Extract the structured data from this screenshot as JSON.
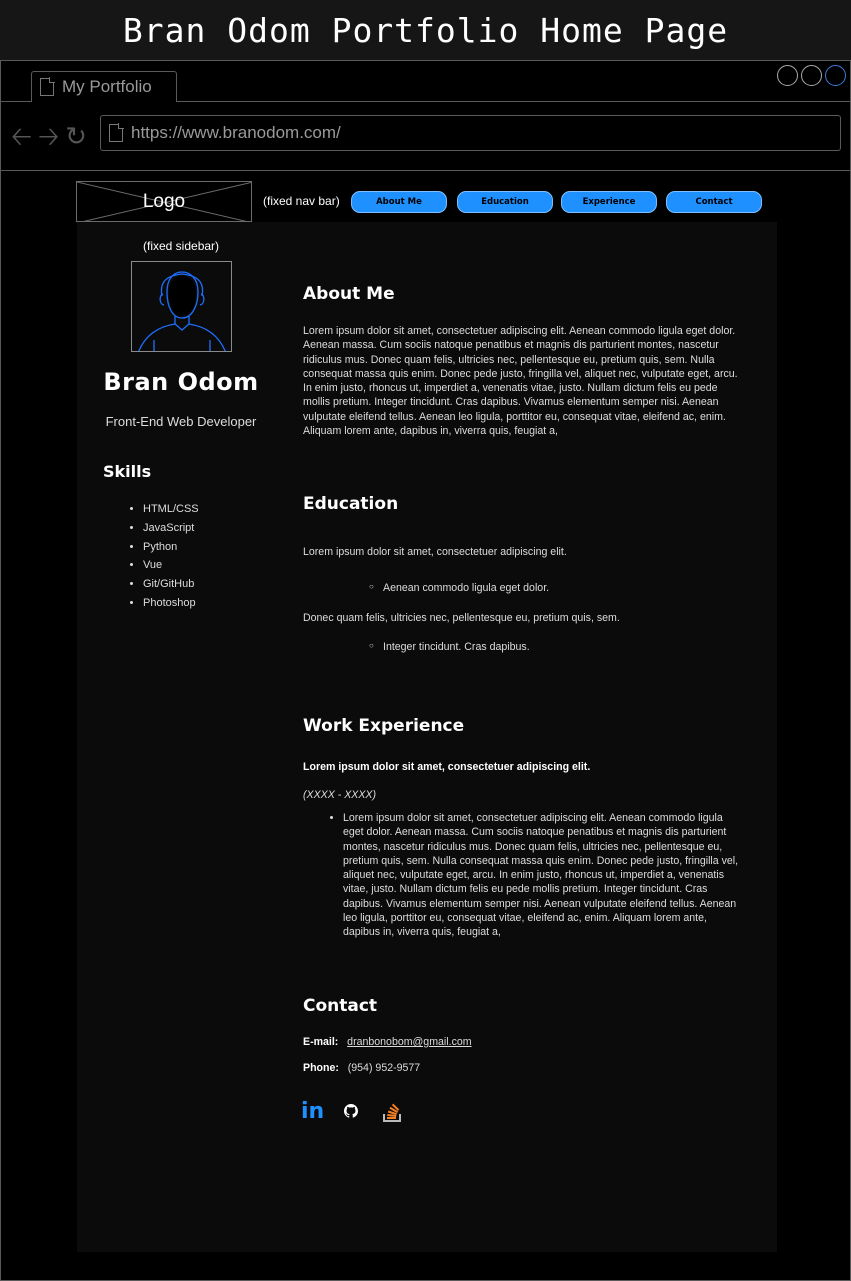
{
  "banner": {
    "title": "Bran Odom Portfolio Home Page"
  },
  "browser": {
    "tab_title": "My Portfolio",
    "url": "https://www.branodom.com/",
    "icons": {
      "back": "back-arrow-icon",
      "forward": "forward-arrow-icon",
      "reload": "reload-icon",
      "page": "page-icon"
    }
  },
  "navbar": {
    "logo": "Logo",
    "note": "(fixed nav bar)",
    "buttons": [
      "About Me",
      "Education",
      "Experience",
      "Contact"
    ],
    "button_color": "#1e90ff"
  },
  "sidebar": {
    "note": "(fixed sidebar)",
    "name": "Bran Odom",
    "role": "Front-End Web Developer",
    "skills_title": "Skills",
    "skills": [
      "HTML/CSS",
      "JavaScript",
      "Python",
      "Vue",
      "Git/GitHub",
      "Photoshop"
    ]
  },
  "about": {
    "title": "About Me",
    "text": "Lorem ipsum dolor sit amet, consectetuer adipiscing elit. Aenean commodo ligula eget dolor. Aenean massa. Cum sociis natoque penatibus et magnis dis parturient montes, nascetur ridiculus mus. Donec quam felis, ultricies nec, pellentesque eu, pretium quis, sem. Nulla consequat massa quis enim. Donec pede justo, fringilla vel, aliquet nec, vulputate eget, arcu. In enim justo, rhoncus ut, imperdiet a, venenatis vitae, justo. Nullam dictum felis eu pede mollis pretium. Integer tincidunt. Cras dapibus. Vivamus elementum semper nisi. Aenean vulputate eleifend tellus. Aenean leo ligula, porttitor eu, consequat vitae, eleifend ac, enim. Aliquam lorem ante, dapibus in, viverra quis, feugiat a,"
  },
  "education": {
    "title": "Education",
    "line1": "Lorem ipsum dolor sit amet, consectetuer adipiscing elit.",
    "item1": "Aenean commodo ligula eget dolor.",
    "line2": "Donec quam felis, ultricies nec, pellentesque eu, pretium quis, sem.",
    "item2": "Integer tincidunt. Cras dapibus."
  },
  "experience": {
    "title": "Work Experience",
    "job_title": "Lorem ipsum dolor sit amet, consectetuer adipiscing elit.",
    "dates": "(XXXX - XXXX)",
    "bullet": "Lorem ipsum dolor sit amet, consectetuer adipiscing elit. Aenean commodo ligula eget dolor. Aenean massa. Cum sociis natoque penatibus et magnis dis parturient montes, nascetur ridiculus mus. Donec quam felis, ultricies nec, pellentesque eu, pretium quis, sem. Nulla consequat massa quis enim. Donec pede justo, fringilla vel, aliquet nec, vulputate eget, arcu. In enim justo, rhoncus ut, imperdiet a, venenatis vitae, justo. Nullam dictum felis eu pede mollis pretium. Integer tincidunt. Cras dapibus. Vivamus elementum semper nisi. Aenean vulputate eleifend tellus. Aenean leo ligula, porttitor eu, consequat vitae, eleifend ac, enim. Aliquam lorem ante, dapibus in, viverra quis, feugiat a,"
  },
  "contact": {
    "title": "Contact",
    "email_label": "E-mail:",
    "email": "dranbonobom@gmail.com",
    "phone_label": "Phone:",
    "phone": "(954) 952-9577",
    "social": [
      {
        "icon": "linkedin-icon",
        "glyph": "in",
        "color": "#1e90ff"
      },
      {
        "icon": "github-icon",
        "color": "#ffffff"
      },
      {
        "icon": "stackoverflow-icon",
        "color": "#f48024"
      }
    ]
  }
}
